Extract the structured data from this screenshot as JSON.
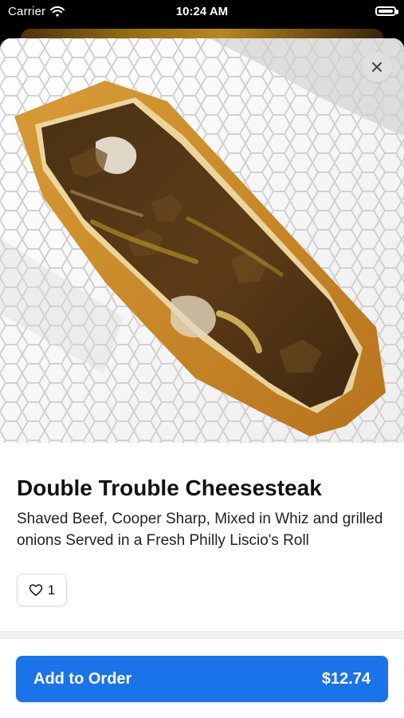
{
  "status_bar": {
    "carrier": "Carrier",
    "time": "10:24 AM",
    "wifi_icon": "wifi-icon",
    "battery_icon": "battery-icon"
  },
  "item": {
    "title": "Double Trouble Cheesesteak",
    "description": "Shaved Beef, Cooper Sharp, Mixed in Whiz and grilled onions Served in a Fresh Philly Liscio's Roll",
    "image_icon": "cheesesteak-photo",
    "close_icon": "close-icon"
  },
  "likes": {
    "count": "1",
    "icon": "heart-icon"
  },
  "footer": {
    "add_to_order_label": "Add to Order",
    "price": "$12.74",
    "button_color": "#1a73e8"
  }
}
